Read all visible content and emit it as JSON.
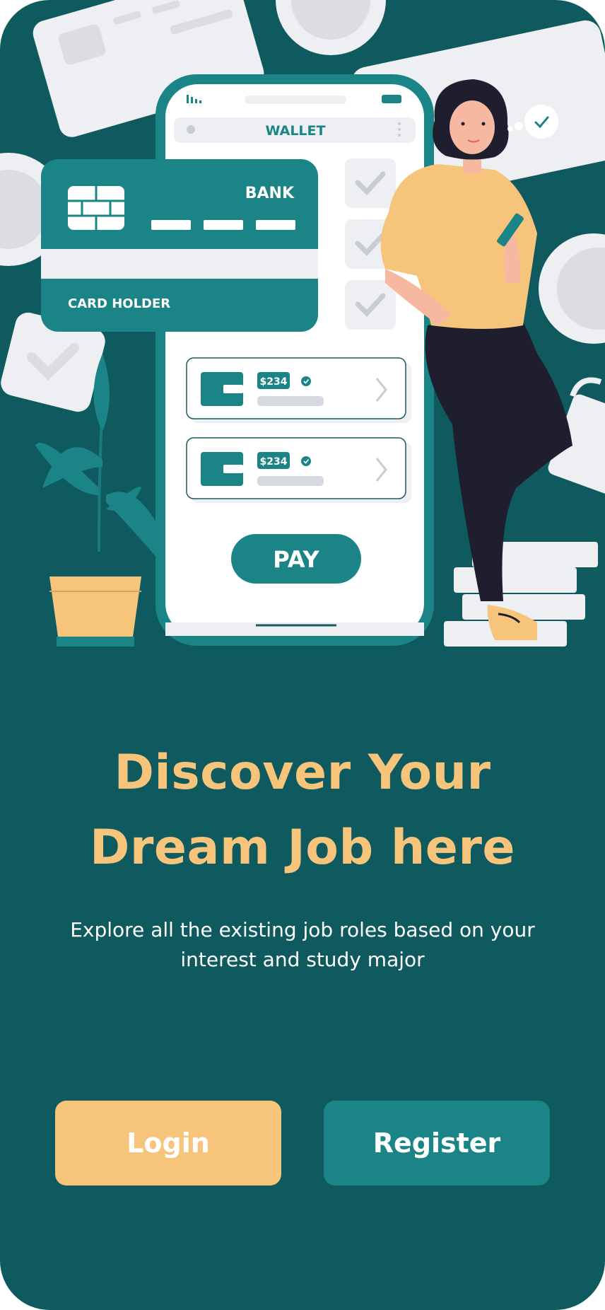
{
  "illustration": {
    "wallet_title": "WALLET",
    "card_bank": "BANK",
    "card_holder": "CARD HOLDER",
    "transactions": [
      {
        "amount": "$234"
      },
      {
        "amount": "$234"
      }
    ],
    "pay_label": "PAY"
  },
  "hero": {
    "title_line1": "Discover Your",
    "title_line2": "Dream Job here",
    "subtitle_line1": "Explore all the existing job roles based on your",
    "subtitle_line2": "interest and study major"
  },
  "actions": {
    "login_label": "Login",
    "register_label": "Register"
  },
  "colors": {
    "background": "#0e5a5e",
    "accent_yellow": "#f6c47a",
    "accent_teal": "#1b8486"
  }
}
